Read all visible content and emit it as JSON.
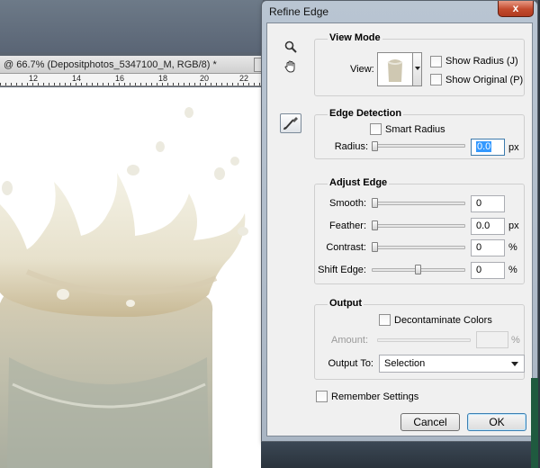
{
  "document": {
    "tab_title": "@ 66.7% (Depositphotos_5347100_M, RGB/8) *",
    "ruler_labels": [
      "12",
      "14",
      "16",
      "18",
      "20",
      "22"
    ]
  },
  "dialog": {
    "title": "Refine Edge",
    "close_glyph": "x",
    "tools": {
      "zoom_icon": "zoom-icon",
      "hand_icon": "hand-icon",
      "refine_brush_icon": "refine-radius-brush-icon"
    },
    "view_mode": {
      "heading": "View Mode",
      "view_label": "View:",
      "show_radius_label": "Show Radius (J)",
      "show_radius_checked": false,
      "show_original_label": "Show Original (P)",
      "show_original_checked": false
    },
    "edge_detection": {
      "heading": "Edge Detection",
      "smart_radius_label": "Smart Radius",
      "smart_radius_checked": false,
      "radius_label": "Radius:",
      "radius_value": "0.0",
      "radius_unit": "px",
      "radius_fraction": 0.0
    },
    "adjust_edge": {
      "heading": "Adjust Edge",
      "smooth_label": "Smooth:",
      "smooth_value": "0",
      "smooth_fraction": 0.0,
      "feather_label": "Feather:",
      "feather_value": "0.0",
      "feather_unit": "px",
      "feather_fraction": 0.0,
      "contrast_label": "Contrast:",
      "contrast_value": "0",
      "contrast_unit": "%",
      "contrast_fraction": 0.0,
      "shift_edge_label": "Shift Edge:",
      "shift_edge_value": "0",
      "shift_edge_unit": "%",
      "shift_edge_fraction": 0.5
    },
    "output": {
      "heading": "Output",
      "decontaminate_label": "Decontaminate Colors",
      "decontaminate_checked": false,
      "amount_label": "Amount:",
      "amount_unit": "%",
      "output_to_label": "Output To:",
      "output_to_value": "Selection"
    },
    "remember_settings_label": "Remember Settings",
    "remember_settings_checked": false,
    "cancel_label": "Cancel",
    "ok_label": "OK"
  },
  "colors": {
    "dialog_frame": "#b9c5d2",
    "close_button": "#c24a2d",
    "ok_border": "#3c7fb1",
    "milk": "#efeee2"
  }
}
